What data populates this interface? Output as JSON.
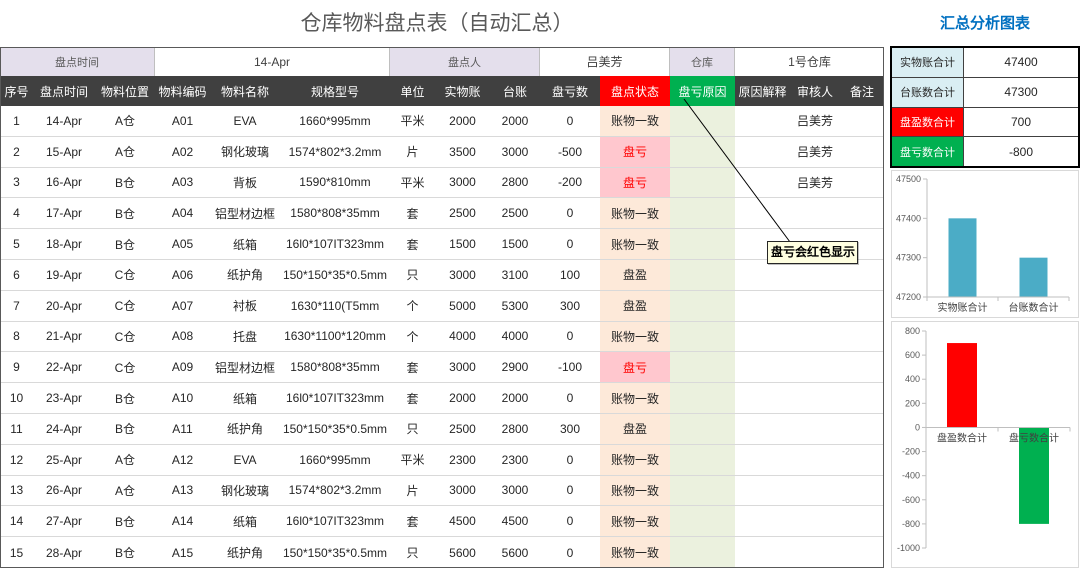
{
  "title": "仓库物料盘点表（自动汇总）",
  "summary_title": "汇总分析图表",
  "info": {
    "date_label": "盘点时间",
    "date_value": "14-Apr",
    "person_label": "盘点人",
    "person_value": "吕美芳",
    "warehouse_label": "仓库",
    "warehouse_value": "1号仓库"
  },
  "table": {
    "columns": [
      "序号",
      "盘点时间",
      "物料位置",
      "物料编码",
      "物料名称",
      "规格型号",
      "单位",
      "实物账",
      "台账",
      "盘亏数",
      "盘点状态",
      "盘亏原因",
      "原因解释",
      "审核人",
      "备注"
    ],
    "rows": [
      [
        "1",
        "14-Apr",
        "A仓",
        "A01",
        "EVA",
        "1660*995mm",
        "平米",
        "2000",
        "2000",
        "0",
        "账物一致",
        "",
        "",
        "吕美芳",
        ""
      ],
      [
        "2",
        "15-Apr",
        "A仓",
        "A02",
        "钢化玻璃",
        "1574*802*3.2mm",
        "片",
        "3500",
        "3000",
        "-500",
        "盘亏",
        "",
        "",
        "吕美芳",
        ""
      ],
      [
        "3",
        "16-Apr",
        "B仓",
        "A03",
        "背板",
        "1590*810mm",
        "平米",
        "3000",
        "2800",
        "-200",
        "盘亏",
        "",
        "",
        "吕美芳",
        ""
      ],
      [
        "4",
        "17-Apr",
        "B仓",
        "A04",
        "铝型材边框",
        "1580*808*35mm",
        "套",
        "2500",
        "2500",
        "0",
        "账物一致",
        "",
        "",
        "",
        ""
      ],
      [
        "5",
        "18-Apr",
        "B仓",
        "A05",
        "纸箱",
        "16l0*107IT323mm",
        "套",
        "1500",
        "1500",
        "0",
        "账物一致",
        "",
        "",
        "",
        ""
      ],
      [
        "6",
        "19-Apr",
        "C仓",
        "A06",
        "纸护角",
        "150*150*35*0.5mm",
        "只",
        "3000",
        "3100",
        "100",
        "盘盈",
        "",
        "",
        "",
        ""
      ],
      [
        "7",
        "20-Apr",
        "C仓",
        "A07",
        "衬板",
        "1630*110(T5mm",
        "个",
        "5000",
        "5300",
        "300",
        "盘盈",
        "",
        "",
        "",
        ""
      ],
      [
        "8",
        "21-Apr",
        "C仓",
        "A08",
        "托盘",
        "1630*1100*120mm",
        "个",
        "4000",
        "4000",
        "0",
        "账物一致",
        "",
        "",
        "",
        ""
      ],
      [
        "9",
        "22-Apr",
        "C仓",
        "A09",
        "铝型材边框",
        "1580*808*35mm",
        "套",
        "3000",
        "2900",
        "-100",
        "盘亏",
        "",
        "",
        "",
        ""
      ],
      [
        "10",
        "23-Apr",
        "B仓",
        "A10",
        "纸箱",
        "16l0*107IT323mm",
        "套",
        "2000",
        "2000",
        "0",
        "账物一致",
        "",
        "",
        "",
        ""
      ],
      [
        "11",
        "24-Apr",
        "B仓",
        "A11",
        "纸护角",
        "150*150*35*0.5mm",
        "只",
        "2500",
        "2800",
        "300",
        "盘盈",
        "",
        "",
        "",
        ""
      ],
      [
        "12",
        "25-Apr",
        "A仓",
        "A12",
        "EVA",
        "1660*995mm",
        "平米",
        "2300",
        "2300",
        "0",
        "账物一致",
        "",
        "",
        "",
        ""
      ],
      [
        "13",
        "26-Apr",
        "A仓",
        "A13",
        "钢化玻璃",
        "1574*802*3.2mm",
        "片",
        "3000",
        "3000",
        "0",
        "账物一致",
        "",
        "",
        "",
        ""
      ],
      [
        "14",
        "27-Apr",
        "B仓",
        "A14",
        "纸箱",
        "16l0*107IT323mm",
        "套",
        "4500",
        "4500",
        "0",
        "账物一致",
        "",
        "",
        "",
        ""
      ],
      [
        "15",
        "28-Apr",
        "B仓",
        "A15",
        "纸护角",
        "150*150*35*0.5mm",
        "只",
        "5600",
        "5600",
        "0",
        "账物一致",
        "",
        "",
        "",
        ""
      ]
    ]
  },
  "comment": "盘亏会红色显示",
  "colors": {
    "info_label_bg": "#E4DFEC",
    "header_bg": "#404040",
    "status_header_bg": "#FF0000",
    "reason_header_bg": "#00B050",
    "status_bg": "#FDE9D9",
    "loss_bg": "#FFC7CE",
    "loss_text": "#FF0000",
    "reason_bg": "#EBF1DE"
  },
  "summary": [
    {
      "label": "实物账合计",
      "value": "47400",
      "label_bg": "#DAEEF3",
      "label_color": "#262626"
    },
    {
      "label": "台账数合计",
      "value": "47300",
      "label_bg": "#DAEEF3",
      "label_color": "#262626"
    },
    {
      "label": "盘盈数合计",
      "value": "700",
      "label_bg": "#FF0000",
      "label_color": "#FFFFFF"
    },
    {
      "label": "盘亏数合计",
      "value": "-800",
      "label_bg": "#00B050",
      "label_color": "#FFFFFF"
    }
  ],
  "chart_data": [
    {
      "type": "bar",
      "categories": [
        "实物账合计",
        "台账数合计"
      ],
      "values": [
        47400,
        47300
      ],
      "ylim": [
        47200,
        47500
      ],
      "yticks": [
        47200,
        47300,
        47400,
        47500
      ],
      "colors": [
        "#4BACC6",
        "#4BACC6"
      ],
      "grid": false,
      "legend": "none"
    },
    {
      "type": "bar",
      "categories": [
        "盘盈数合计",
        "盘亏数合计"
      ],
      "values": [
        700,
        -800
      ],
      "ylim": [
        -1000,
        800
      ],
      "yticks": [
        -1000,
        -800,
        -600,
        -400,
        -200,
        0,
        200,
        400,
        600,
        800
      ],
      "colors": [
        "#FF0000",
        "#00B050"
      ],
      "grid": false,
      "legend": "none"
    }
  ]
}
